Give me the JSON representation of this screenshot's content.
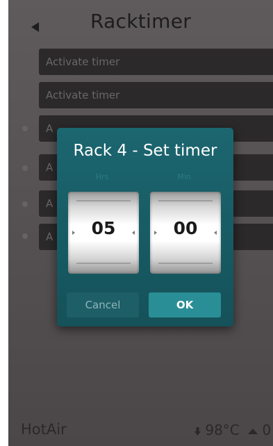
{
  "header": {
    "title": "Racktimer",
    "back_icon": "back-arrow-icon"
  },
  "rows": [
    {
      "label": "Activate timer"
    },
    {
      "label": "Activate timer"
    },
    {
      "label": "A"
    },
    {
      "label": "A"
    },
    {
      "label": "A"
    },
    {
      "label": "A"
    }
  ],
  "dialog": {
    "title": "Rack 4 - Set timer",
    "hours": {
      "label": "Hrs",
      "value": "05"
    },
    "minutes": {
      "label": "Min",
      "value": "00"
    },
    "cancel_label": "Cancel",
    "ok_label": "OK"
  },
  "footer": {
    "mode": "HotAir",
    "temperature": "98°C",
    "count": "0"
  },
  "colors": {
    "background": "#56525",
    "dialog": "#1c6670",
    "ok_button": "#2a8e96"
  }
}
